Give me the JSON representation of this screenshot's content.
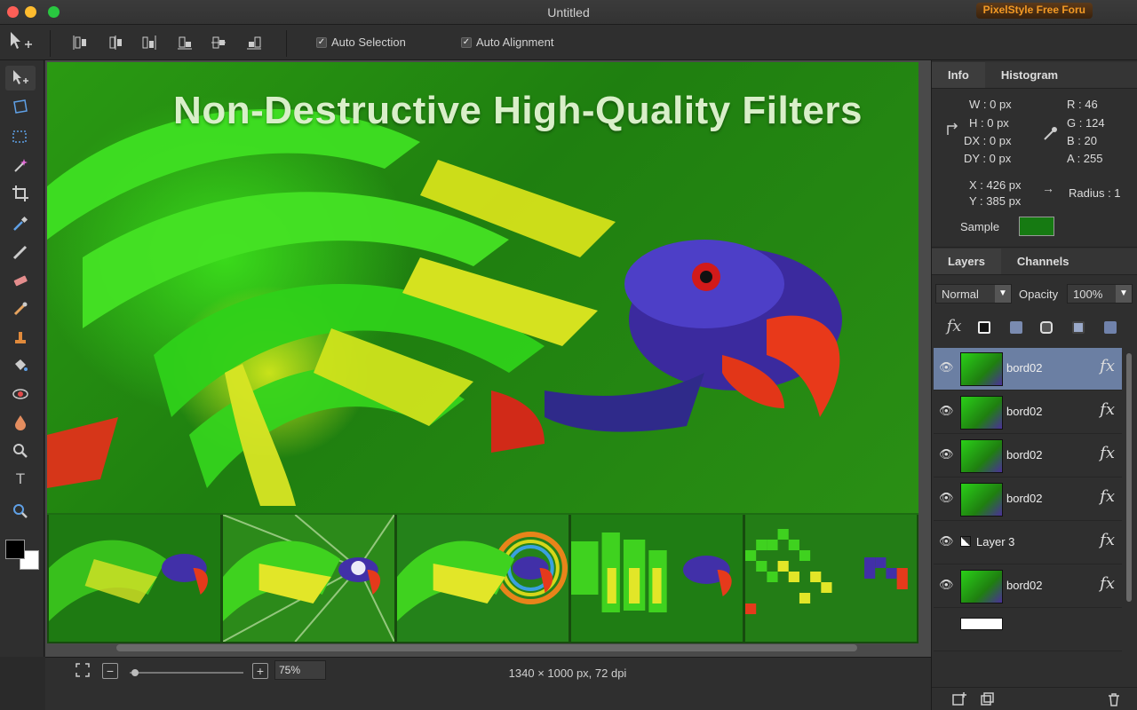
{
  "window": {
    "title": "Untitled",
    "badge": "PixelStyle Free Foru"
  },
  "toolbar": {
    "auto_selection": "Auto Selection",
    "auto_alignment": "Auto Alignment",
    "auto_selection_checked": true,
    "auto_alignment_checked": true
  },
  "canvas": {
    "headline": "Non-Destructive High-Quality Filters"
  },
  "statusbar": {
    "zoom": "75%",
    "dimensions": "1340 × 1000 px, 72 dpi"
  },
  "info_panel": {
    "tabs": [
      "Info",
      "Histogram"
    ],
    "w": "W :  0 px",
    "h": "H :  0 px",
    "dx": "DX :  0 px",
    "dy": "DY :  0 px",
    "r": "R :   46",
    "g": "G :  124",
    "b": "B :   20",
    "a": "A :  255",
    "x": "X :  426 px",
    "y": "Y :  385 px",
    "radius": "Radius :  1",
    "sample": "Sample",
    "sample_color": "#167a12"
  },
  "layers_panel": {
    "tabs": [
      "Layers",
      "Channels"
    ],
    "blend_mode": "Normal",
    "opacity_label": "Opacity",
    "opacity": "100%",
    "fx": "fx",
    "layers": [
      {
        "name": "bord02",
        "selected": true
      },
      {
        "name": "bord02",
        "selected": false
      },
      {
        "name": "bord02",
        "selected": false
      },
      {
        "name": "bord02",
        "selected": false
      },
      {
        "name": "Layer 3",
        "selected": false
      },
      {
        "name": "bord02",
        "selected": false
      }
    ]
  },
  "colors": {
    "accent_selected": "#6b7fa3",
    "badge_text": "#f39a25"
  }
}
